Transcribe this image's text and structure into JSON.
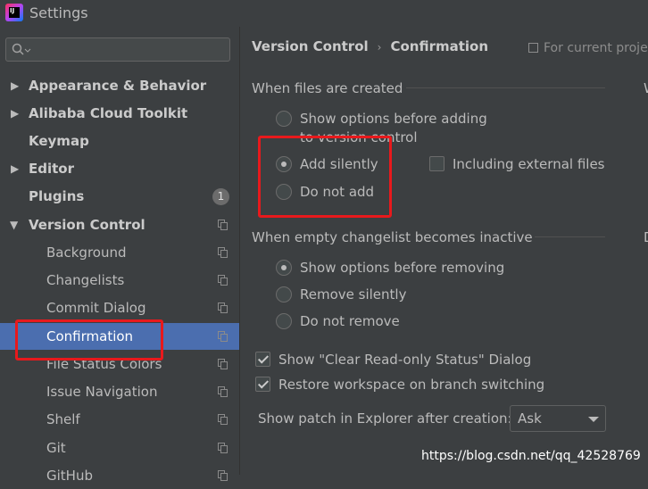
{
  "window": {
    "title": "Settings",
    "app_icon_text": "IJ"
  },
  "sidebar": {
    "search_placeholder": "",
    "items": [
      {
        "label": "Appearance & Behavior",
        "expandable": true,
        "expanded": false
      },
      {
        "label": "Alibaba Cloud Toolkit",
        "expandable": true,
        "expanded": false
      },
      {
        "label": "Keymap",
        "expandable": false
      },
      {
        "label": "Editor",
        "expandable": true,
        "expanded": false
      },
      {
        "label": "Plugins",
        "badge": "1"
      },
      {
        "label": "Version Control",
        "expandable": true,
        "expanded": true
      },
      {
        "label": "Background"
      },
      {
        "label": "Changelists"
      },
      {
        "label": "Commit Dialog"
      },
      {
        "label": "Confirmation",
        "selected": true
      },
      {
        "label": "File Status Colors"
      },
      {
        "label": "Issue Navigation"
      },
      {
        "label": "Shelf"
      },
      {
        "label": "Git"
      },
      {
        "label": "GitHub"
      }
    ]
  },
  "header": {
    "breadcrumb_parent": "Version Control",
    "breadcrumb_separator": "›",
    "breadcrumb_current": "Confirmation",
    "scope_label": "For current proje"
  },
  "files_created": {
    "title": "When files are created",
    "options": [
      {
        "label": "Show options before adding",
        "label_line2": "to version control",
        "checked": false
      },
      {
        "label": "Add silently",
        "checked": true
      },
      {
        "label": "Do not add",
        "checked": false
      }
    ],
    "including_external": {
      "label": "Including external files",
      "checked": false
    },
    "edge_letter": "W"
  },
  "changelist_inactive": {
    "title": "When empty changelist becomes inactive",
    "options": [
      {
        "label": "Show options before removing",
        "checked": true
      },
      {
        "label": "Remove silently",
        "checked": false
      },
      {
        "label": "Do not remove",
        "checked": false
      }
    ],
    "edge_letter": "D"
  },
  "checkboxes": [
    {
      "label": "Show \"Clear Read-only Status\" Dialog",
      "checked": true
    },
    {
      "label": "Restore workspace on branch switching",
      "checked": true
    }
  ],
  "patch": {
    "label": "Show patch in Explorer after creation:",
    "selected": "Ask"
  },
  "watermark": "https://blog.csdn.net/qq_42528769",
  "colors": {
    "background": "#3c3f41",
    "selection": "#4b6eaf",
    "highlight": "#e8191c",
    "text": "#bbbbbb"
  }
}
